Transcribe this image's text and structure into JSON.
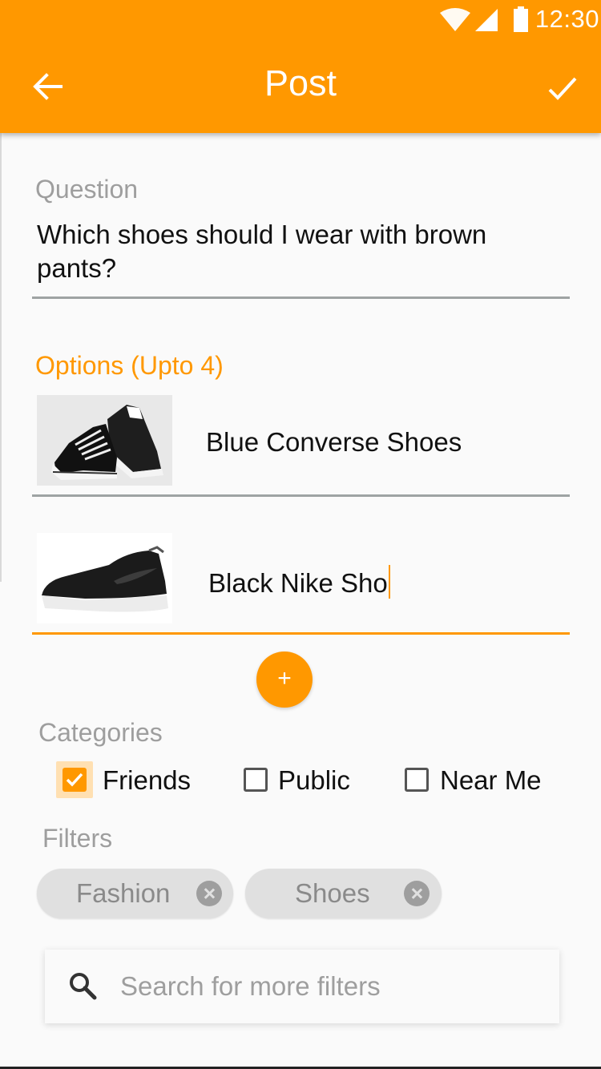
{
  "status_bar": {
    "time": "12:30"
  },
  "toolbar": {
    "title": "Post"
  },
  "question": {
    "label": "Question",
    "value": "Which shoes should I wear with brown pants?"
  },
  "options": {
    "label": "Options (Upto 4)",
    "items": [
      {
        "text": "Blue Converse Shoes"
      },
      {
        "text": "Black Nike Sho"
      }
    ]
  },
  "categories": {
    "label": "Categories",
    "items": [
      {
        "label": "Friends",
        "checked": true
      },
      {
        "label": "Public",
        "checked": false
      },
      {
        "label": "Near Me",
        "checked": false
      }
    ]
  },
  "filters": {
    "label": "Filters",
    "chips": [
      {
        "label": "Fashion"
      },
      {
        "label": "Shoes"
      }
    ]
  },
  "search": {
    "placeholder": "Search for more filters"
  },
  "colors": {
    "accent": "#ff9800",
    "chip_bg": "#e0e0e0"
  },
  "icons": [
    "wifi-icon",
    "signal-icon",
    "battery-icon",
    "back-arrow-icon",
    "check-icon",
    "add-icon",
    "search-icon",
    "close-circle-icon"
  ]
}
